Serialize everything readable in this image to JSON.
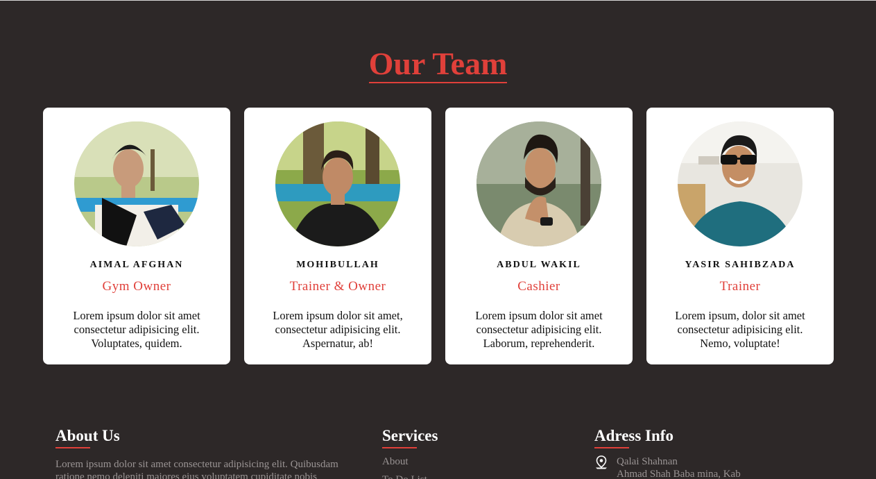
{
  "team": {
    "title": "Our Team",
    "members": [
      {
        "name": "AIMAL AFGHAN",
        "role": "Gym Owner",
        "desc_lines": [
          "Lorem ipsum dolor sit amet",
          "consectetur adipisicing elit.",
          "Voluptates, quidem."
        ]
      },
      {
        "name": "MOHIBULLAH",
        "role": "Trainer & Owner",
        "desc_lines": [
          "Lorem ipsum dolor sit amet,",
          "consectetur adipisicing elit.",
          "Aspernatur, ab!"
        ]
      },
      {
        "name": "ABDUL WAKIL",
        "role": "Cashier",
        "desc_lines": [
          "Lorem ipsum dolor sit amet",
          "consectetur adipisicing elit.",
          "Laborum, reprehenderit."
        ]
      },
      {
        "name": "YASIR SAHIBZADA",
        "role": "Trainer",
        "desc_lines": [
          "Lorem ipsum, dolor sit amet",
          "consectetur adipisicing elit.",
          "Nemo, voluptate!"
        ]
      }
    ]
  },
  "footer": {
    "about": {
      "heading": "About Us",
      "text_lines": [
        "Lorem ipsum dolor sit amet consectetur adipisicing elit. Quibusdam",
        "ratione nemo deleniti maiores eius voluptatem cupiditate nobis"
      ]
    },
    "services": {
      "heading": "Services",
      "links": [
        "About",
        "To Do List"
      ]
    },
    "address": {
      "heading": "Adress Info",
      "icon": "map-pin-icon",
      "lines": [
        "Qalai Shahnan",
        "Ahmad Shah Baba mina, Kab"
      ]
    }
  },
  "colors": {
    "background": "#2d2828",
    "accent": "#e0403a",
    "card": "#ffffff"
  }
}
